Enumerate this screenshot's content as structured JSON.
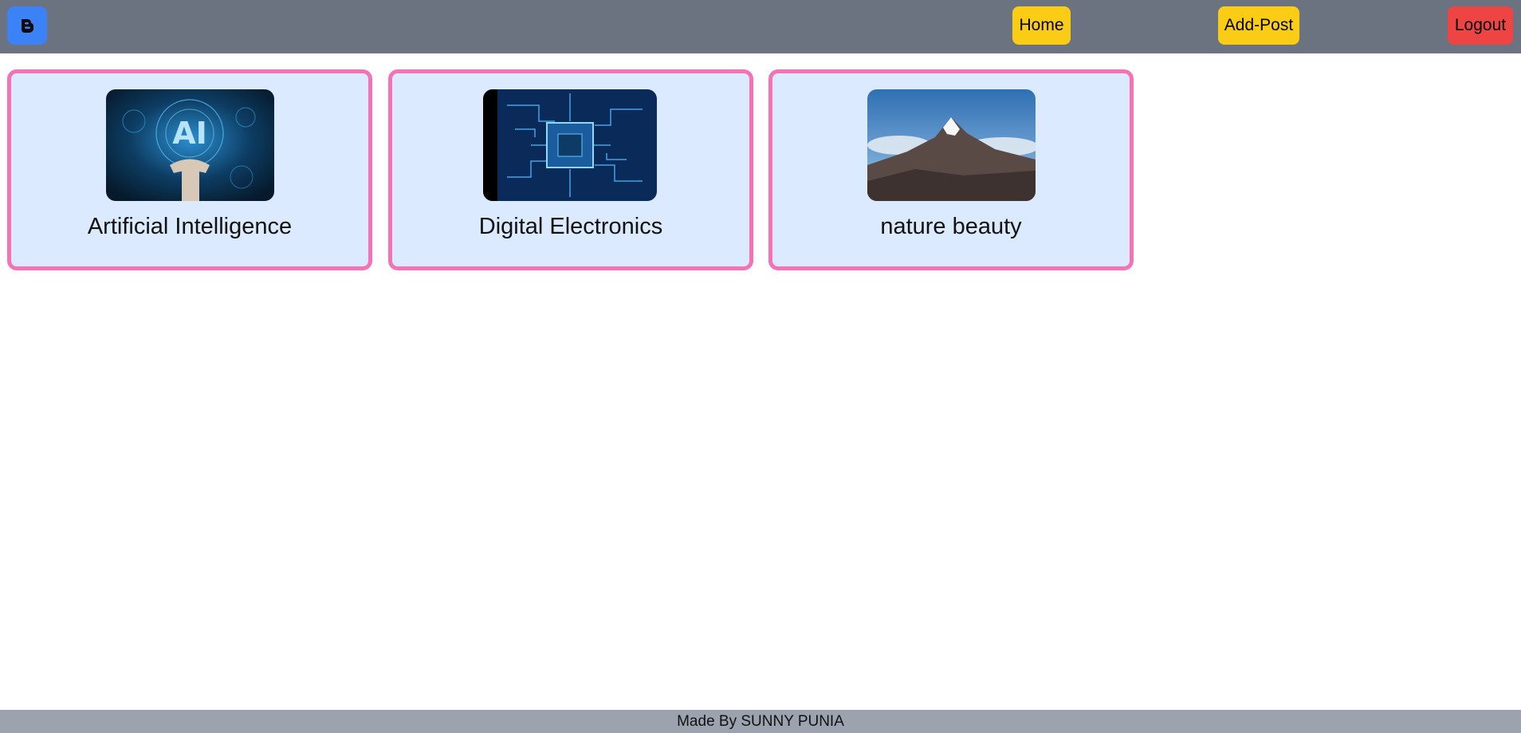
{
  "navbar": {
    "logo_icon": "blogger-icon",
    "home_label": "Home",
    "add_post_label": "Add-Post",
    "logout_label": "Logout"
  },
  "posts": [
    {
      "title": "Artificial Intelligence",
      "image": "ai-image"
    },
    {
      "title": "Digital Electronics",
      "image": "circuit-chip-image"
    },
    {
      "title": "nature beauty",
      "image": "mountain-image"
    }
  ],
  "footer": {
    "text": "Made By SUNNY PUNIA"
  },
  "colors": {
    "navbar": "#6b7280",
    "logo": "#3b82f6",
    "nav_button": "#facc15",
    "logout_button": "#ef4444",
    "card_bg": "#dbeafe",
    "card_border": "#f472b6",
    "footer": "#9ca3af"
  }
}
